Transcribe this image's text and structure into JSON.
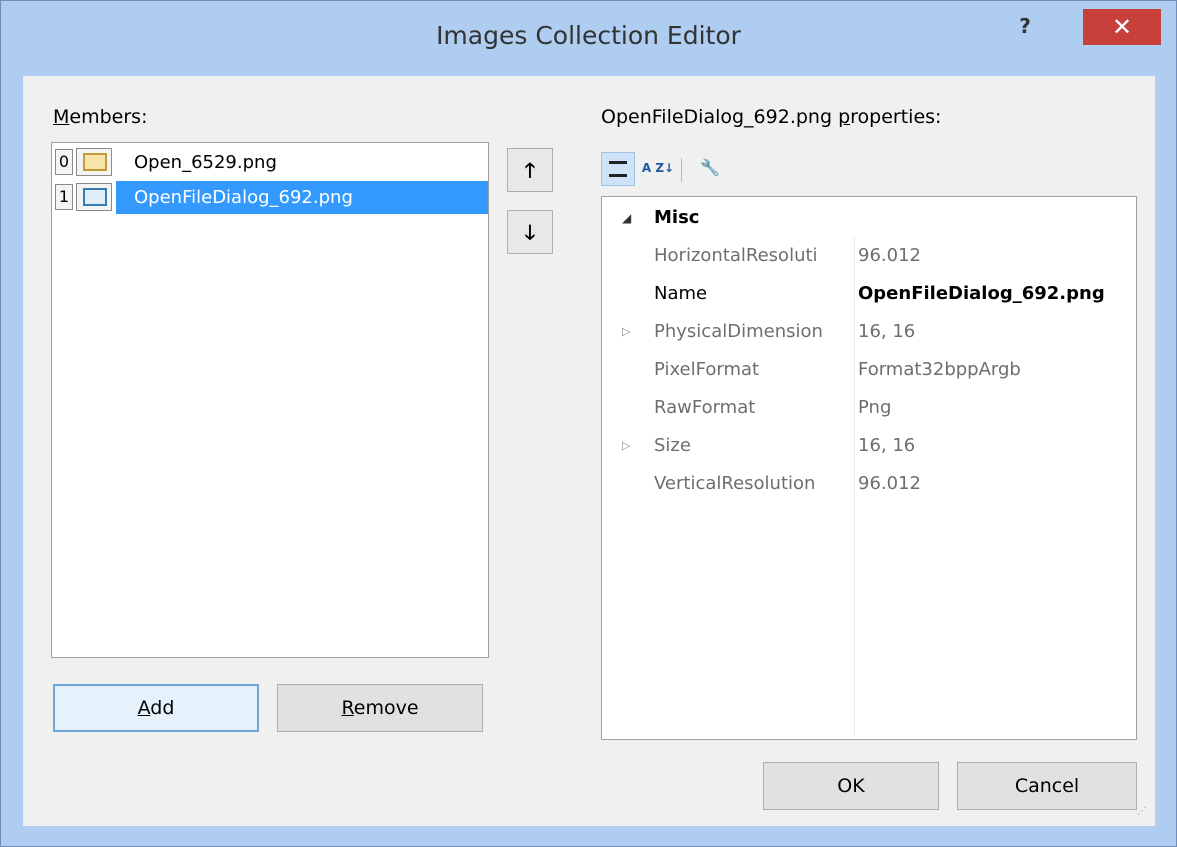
{
  "window": {
    "title": "Images Collection Editor",
    "help_label": "?",
    "close_label": "✕"
  },
  "members": {
    "label_underlined": "M",
    "label_rest": "embers:",
    "items": [
      {
        "index": "0",
        "name": "Open_6529.png",
        "icon": "folder-image-icon",
        "selected": false
      },
      {
        "index": "1",
        "name": "OpenFileDialog_692.png",
        "icon": "dialog-image-icon",
        "selected": true
      }
    ],
    "move_up_label": "🡑",
    "move_down_label": "🡓"
  },
  "buttons": {
    "add_underlined": "A",
    "add_rest": "dd",
    "remove_underlined": "R",
    "remove_rest": "emove",
    "ok": "OK",
    "cancel": "Cancel"
  },
  "properties": {
    "label_prefix": "OpenFileDialog_692.png ",
    "label_underlined": "p",
    "label_rest": "roperties:",
    "toolbar": {
      "categorized": "categorized-icon",
      "alphabetical": "alphabetical-icon",
      "alphabetical_glyph": "A Z↓",
      "property_pages": "wrench-icon",
      "property_pages_glyph": "🔧"
    },
    "category": {
      "name": "Misc",
      "toggle": "◢"
    },
    "rows": [
      {
        "name": "HorizontalResoluti",
        "value": "96.012",
        "expander": "",
        "editable": false
      },
      {
        "name": "Name",
        "value": "OpenFileDialog_692.png",
        "expander": "",
        "editable": true
      },
      {
        "name": "PhysicalDimension",
        "value": "16, 16",
        "expander": "▷",
        "editable": false
      },
      {
        "name": "PixelFormat",
        "value": "Format32bppArgb",
        "expander": "",
        "editable": false
      },
      {
        "name": "RawFormat",
        "value": "Png",
        "expander": "",
        "editable": false
      },
      {
        "name": "Size",
        "value": "16, 16",
        "expander": "▷",
        "editable": false
      },
      {
        "name": "VerticalResolution",
        "value": "96.012",
        "expander": "",
        "editable": false
      }
    ]
  },
  "colors": {
    "title_bg": "#aecdf1",
    "close_bg": "#c7403a",
    "selection": "#3399ff"
  }
}
